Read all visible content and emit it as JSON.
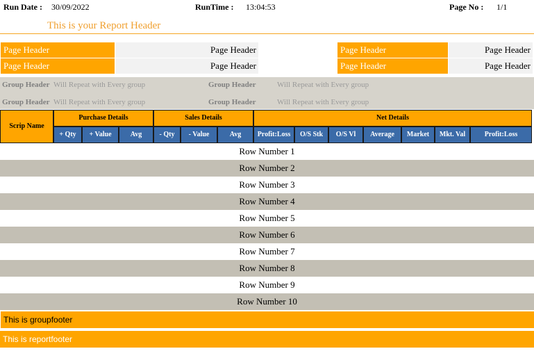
{
  "top": {
    "run_date_label": "Run Date :",
    "run_date": "30/09/2022",
    "run_time_label": "RunTime :",
    "run_time": "13:04:53",
    "page_no_label": "Page No :",
    "page_no": "1/1"
  },
  "report_header": "This is your Report Header",
  "page_headers": {
    "orange": [
      "Page Header",
      "Page Header",
      "Page Header",
      "Page Header"
    ],
    "grey": [
      "Page Header",
      "Page Header",
      "Page Header",
      "Page Header"
    ]
  },
  "group_headers": {
    "title": "Group Header",
    "text": "Will Repeat with Every group"
  },
  "table": {
    "scrip_name": "Scrip Name",
    "groups": [
      "Purchase Details",
      "Sales Details",
      "Net Details"
    ],
    "columns": [
      "+ Qty",
      "+ Value",
      "Avg",
      "- Qty",
      "- Value",
      "Avg",
      "Profit:Loss",
      "O/S Stk",
      "O/S Vl",
      "Average",
      "Market",
      "Mkt. Val",
      "Profit:Loss"
    ],
    "rows": [
      "Row Number 1",
      "Row Number 2",
      "Row Number 3",
      "Row Number 4",
      "Row Number 5",
      "Row Number 6",
      "Row Number 7",
      "Row Number 8",
      "Row Number 9",
      "Row Number 10"
    ]
  },
  "group_footer": "This is groupfooter",
  "report_footer": "This is reportfooter",
  "colors": {
    "accent": "#ffa500",
    "header_blue": "#3b6ba8",
    "band_grey": "#d6d3cb",
    "row_alt": "#c3bfb4"
  }
}
